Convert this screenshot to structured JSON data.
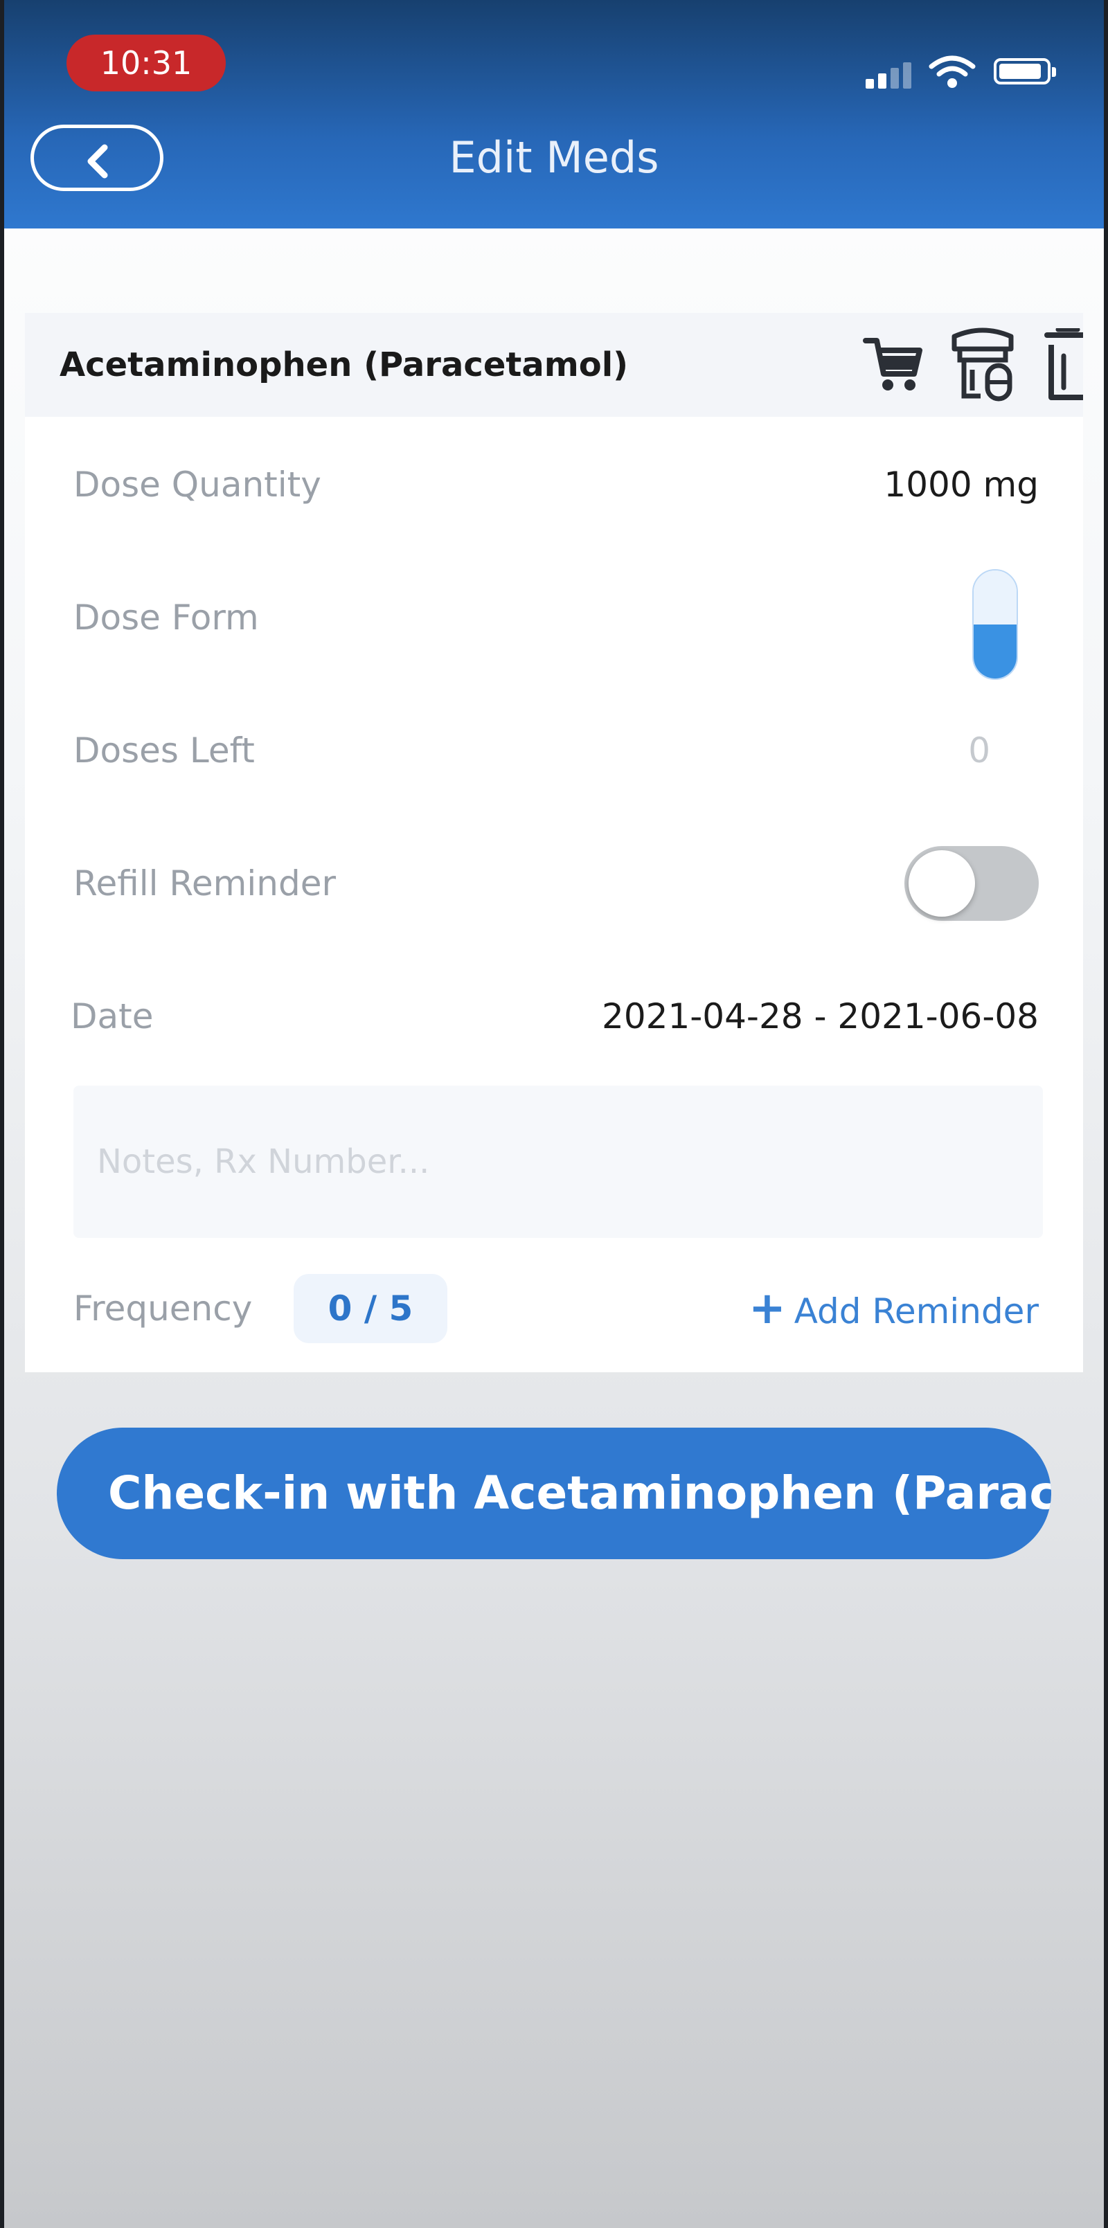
{
  "status_bar": {
    "time": "10:31"
  },
  "header": {
    "title": "Edit Meds"
  },
  "medication": {
    "name": "Acetaminophen (Paracetamol)"
  },
  "details": {
    "dose_quantity_label": "Dose Quantity",
    "dose_quantity_value": "1000 mg",
    "dose_form_label": "Dose Form",
    "doses_left_label": "Doses Left",
    "doses_left_value": "0",
    "refill_reminder_label": "Refill Reminder",
    "date_label": "Date",
    "date_value": "2021-04-28 - 2021-06-08",
    "notes_placeholder": "Notes, Rx Number...",
    "frequency_label": "Frequency",
    "frequency_value": "0 / 5",
    "add_reminder_label": "Add Reminder"
  },
  "checkin": {
    "label": "Check-in with Acetaminophen (Paracetamol)"
  },
  "colors": {
    "header_blue": "#2767b7",
    "accent_blue": "#3079d0",
    "status_red": "#c8282a",
    "capsule_blue": "#3a92e3"
  },
  "icons": {
    "back": "chevron-left-icon",
    "cart": "cart-icon",
    "dose_cup": "pill-cup-icon",
    "trash": "trash-icon",
    "dose_form": "capsule-icon",
    "add": "plus-icon"
  },
  "toggles": {
    "refill_reminder_on": false
  }
}
